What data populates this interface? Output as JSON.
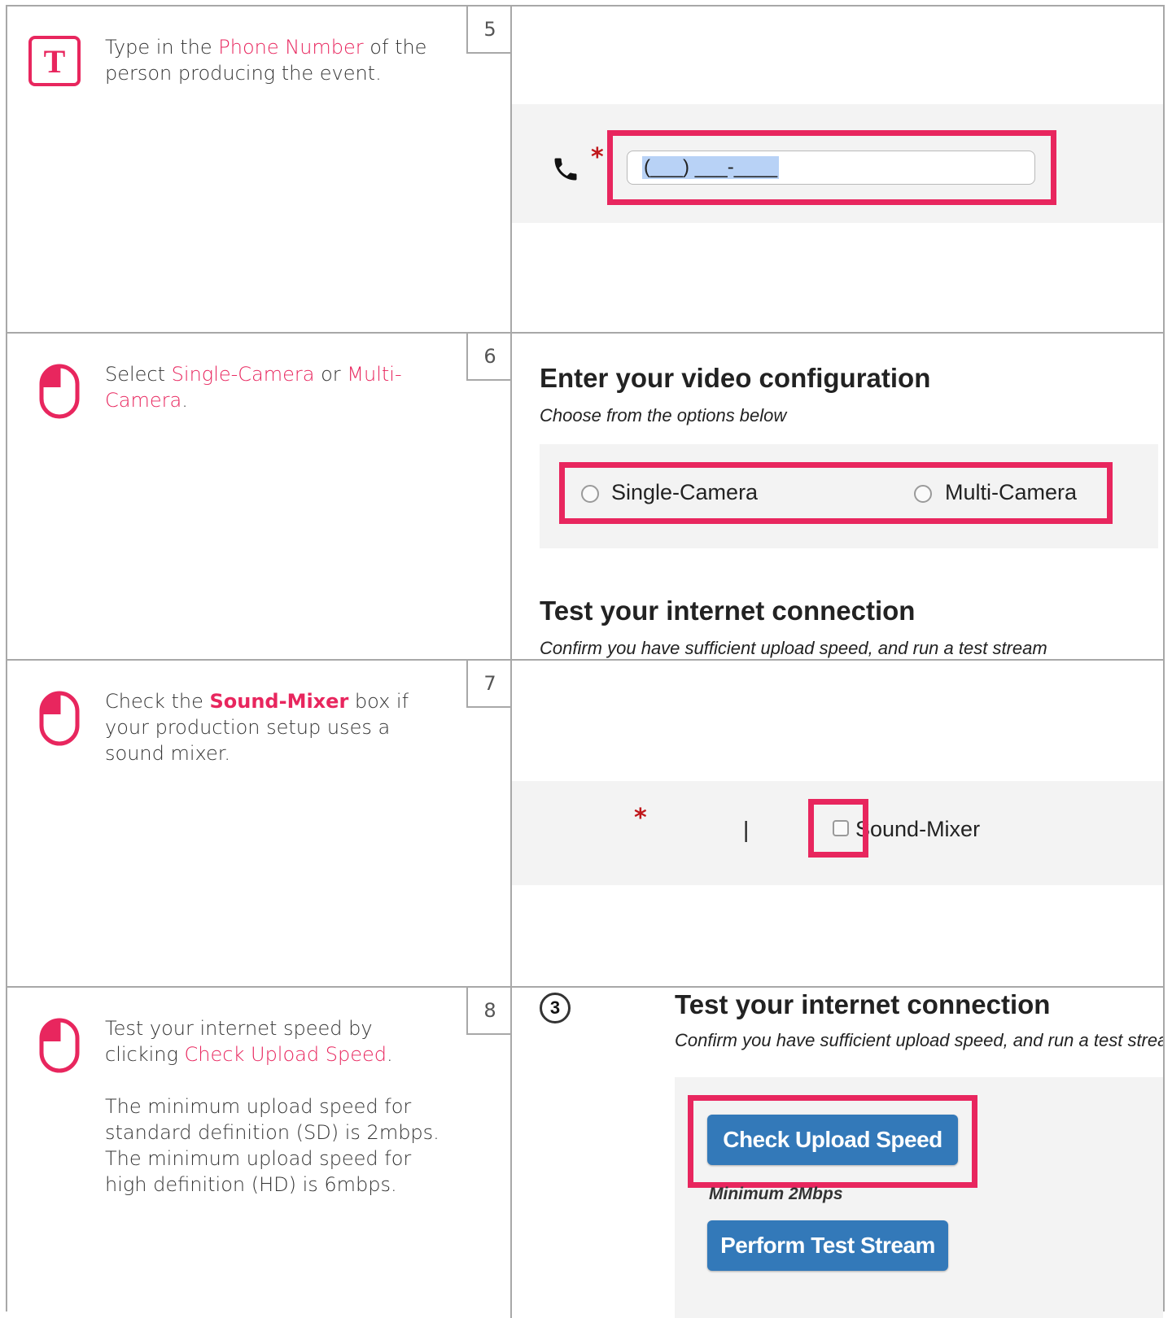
{
  "steps": [
    {
      "number": "5",
      "icon": "text-input-icon",
      "icon_letter": "T",
      "text_before": "Type in the ",
      "highlight": "Phone Number",
      "text_after": " of the person producing the event.",
      "phone_placeholder": "(___) ___-____",
      "required_mark": "*"
    },
    {
      "number": "6",
      "icon": "mouse-click-icon",
      "text_before": "Select ",
      "highlight_1": "Single-Camera",
      "text_mid": " or ",
      "highlight_2": "Multi-Camera",
      "text_after": ".",
      "heading": "Enter your video configuration",
      "subheading": "Choose from the options below",
      "option_1": "Single-Camera",
      "option_2": "Multi-Camera",
      "heading_2": "Test your internet connection",
      "subheading_2": "Confirm you have sufficient upload speed, and run a test stream"
    },
    {
      "number": "7",
      "icon": "mouse-click-icon",
      "text_before": "Check the ",
      "highlight": "Sound-Mixer",
      "text_after": " box if your production setup uses a sound mixer.",
      "required_mark": "*",
      "separator": "|",
      "checkbox_label": "Sound-Mixer"
    },
    {
      "number": "8",
      "icon": "mouse-click-icon",
      "text_before": "Test your internet speed by clicking ",
      "highlight": "Check Upload Speed",
      "text_after": ".",
      "para_2": "The minimum upload speed for standard definition (SD) is 2mbps.",
      "para_3": "The minimum upload speed for high definition (HD) is 6mbps.",
      "section_number": "3",
      "heading": "Test your internet connection",
      "subheading": "Confirm you have sufficient upload speed, and run a test stream",
      "check_button": "Check Upload Speed",
      "minimum_note": "Minimum 2Mbps",
      "test_button": "Perform Test Stream"
    }
  ],
  "colors": {
    "accent": "#e8265e",
    "button_blue": "#3379b9",
    "border": "#a8a8a8"
  }
}
